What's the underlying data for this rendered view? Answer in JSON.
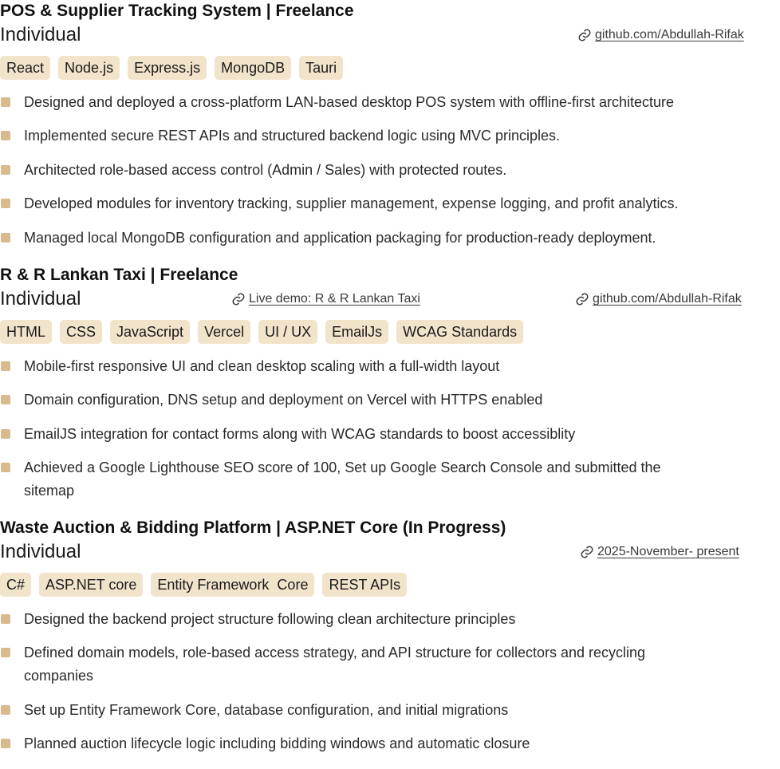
{
  "projects": [
    {
      "title": "POS & Supplier Tracking System | Freelance",
      "role": "Individual",
      "links": [
        "github.com/Abdullah-Rifak"
      ],
      "tags": [
        "React",
        "Node.js",
        "Express.js",
        "MongoDB",
        "Tauri"
      ],
      "bullets": [
        "Designed and deployed a cross-platform LAN-based desktop POS system with offline-first architecture",
        "Implemented secure REST APIs and structured backend logic using MVC principles.",
        "Architected role-based access control (Admin / Sales) with protected routes.",
        "Developed modules for inventory tracking, supplier management, expense logging, and profit analytics.",
        "Managed local MongoDB configuration and application packaging for production-ready deployment."
      ]
    },
    {
      "title": "R & R Lankan Taxi | Freelance",
      "role": "Individual",
      "links": [
        "Live demo: R & R Lankan Taxi",
        "github.com/Abdullah-Rifak"
      ],
      "tags": [
        "HTML",
        "CSS",
        "JavaScript",
        "Vercel",
        "UI / UX",
        "EmailJs",
        "WCAG Standards"
      ],
      "bullets": [
        "Mobile-first responsive UI and clean desktop scaling with a full-width layout",
        "Domain configuration, DNS setup and deployment on Vercel with HTTPS enabled",
        "EmailJS integration for contact forms along with WCAG standards to boost accessiblity",
        "Achieved a Google Lighthouse SEO score of 100,  Set up Google Search Console and submitted the sitemap"
      ]
    },
    {
      "title": "Waste Auction & Bidding Platform | ASP.NET Core (In Progress)",
      "role": "Individual",
      "links": [
        "2025-November- present"
      ],
      "tags": [
        "C#",
        "ASP.NET core",
        "Entity Framework  Core",
        "REST APIs"
      ],
      "bullets": [
        "Designed the backend project structure following clean architecture principles",
        "Defined domain models, role-based access strategy, and API structure for collectors and recycling companies",
        "Set up Entity Framework Core, database configuration, and initial migrations",
        "Planned auction lifecycle logic including bidding windows and automatic closure"
      ]
    }
  ],
  "icons": {
    "link": "link-icon"
  },
  "colors": {
    "tag_bg": "#f2e4cb",
    "bullet": "#d9b98e"
  }
}
